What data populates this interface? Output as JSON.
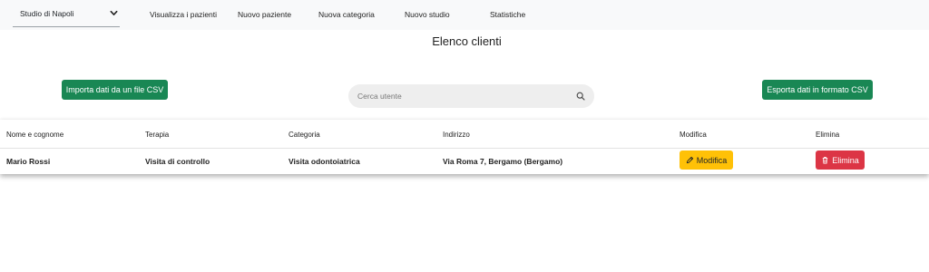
{
  "nav": {
    "studio_selected": "Studio di Napoli",
    "links": [
      "Visualizza i pazienti",
      "Nuovo paziente",
      "Nuova categoria",
      "Nuovo studio",
      "Statistiche"
    ]
  },
  "page": {
    "title": "Elenco clienti"
  },
  "actions": {
    "import_label": "Importa dati da un file CSV",
    "export_label": "Esporta dati in formato CSV"
  },
  "search": {
    "placeholder": "Cerca utente",
    "value": ""
  },
  "table": {
    "headers": [
      "Nome e cognome",
      "Terapia",
      "Categoria",
      "Indirizzo",
      "Modifica",
      "Elimina"
    ],
    "rows": [
      {
        "name": "Mario Rossi",
        "therapy": "Visita di controllo",
        "category": "Visita odontoiatrica",
        "address": "Via Roma 7, Bergamo (Bergamo)",
        "edit_label": "Modifica",
        "delete_label": "Elimina"
      }
    ]
  },
  "icons": {
    "select": "chevron-down-icon",
    "search": "search-icon",
    "edit": "pencil-icon",
    "delete": "trash-icon"
  },
  "colors": {
    "success": "#198754",
    "warning": "#ffc107",
    "danger": "#dc3545",
    "navbar": "#f8f9fa",
    "search_bg": "#eeeeee"
  }
}
